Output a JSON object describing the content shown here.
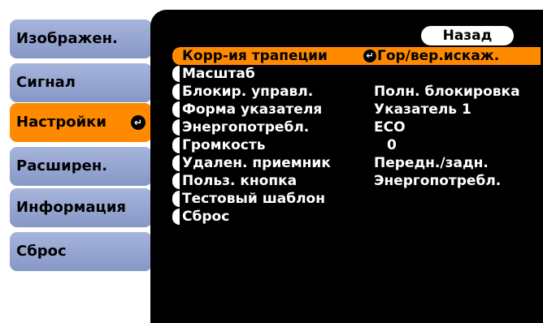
{
  "tabs": [
    {
      "label": "Изображен."
    },
    {
      "label": "Сигнал"
    },
    {
      "label": "Настройки"
    },
    {
      "label": "Расширен."
    },
    {
      "label": "Информация"
    },
    {
      "label": "Сброс"
    }
  ],
  "active_tab_index": 2,
  "back_label": "Назад",
  "menu": [
    {
      "label": "Корр-ия трапеции",
      "value": "Гор/вер.искаж."
    },
    {
      "label": "Масштаб",
      "value": ""
    },
    {
      "label": "Блокир. управл.",
      "value": "Полн. блокировка"
    },
    {
      "label": "Форма указателя",
      "value": "Указатель 1"
    },
    {
      "label": "Энергопотребл.",
      "value": "ECO"
    },
    {
      "label": "Громкость",
      "value": "0"
    },
    {
      "label": "Удален. приемник",
      "value": "Передн./задн."
    },
    {
      "label": "Польз. кнопка",
      "value": "Энергопотребл."
    },
    {
      "label": "Тестовый шаблон",
      "value": ""
    },
    {
      "label": "Сброс",
      "value": ""
    }
  ],
  "enter_icon": "enter-arrow-icon",
  "colors": {
    "active": "#ff8a00",
    "tab": "#98a8d4",
    "panel": "#000000",
    "text": "#ffffff"
  }
}
